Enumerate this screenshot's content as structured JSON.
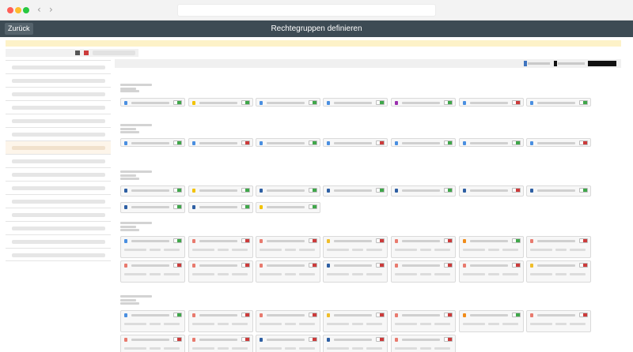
{
  "window": {
    "traffic_colors": [
      "#ff5f57",
      "#febc2e",
      "#28c840"
    ]
  },
  "header": {
    "title": "Rechtegruppen definieren",
    "back_label": "Zurück"
  },
  "colors": {
    "blue": "#4a8fe0",
    "yellow": "#f2c200",
    "purple": "#9b2fae",
    "green": "#3fa74a",
    "red": "#cc3b3b",
    "navy": "#2e5fa3",
    "salmon": "#e87a6e",
    "orange": "#f08c1a",
    "mustard": "#efbd2a"
  },
  "sidebar": {
    "item_count": 15,
    "active_index": 6
  },
  "sections": [
    {
      "cards": [
        {
          "icon": "blue",
          "state": "green"
        },
        {
          "icon": "yellow",
          "state": "green"
        },
        {
          "icon": "blue",
          "state": "green"
        },
        {
          "icon": "blue",
          "state": "green"
        },
        {
          "icon": "purple",
          "state": "green"
        },
        {
          "icon": "blue",
          "state": "red"
        },
        {
          "icon": "blue",
          "state": "green"
        }
      ]
    },
    {
      "cards": [
        {
          "icon": "blue",
          "state": "green"
        },
        {
          "icon": "blue",
          "state": "red"
        },
        {
          "icon": "blue",
          "state": "green"
        },
        {
          "icon": "blue",
          "state": "red"
        },
        {
          "icon": "blue",
          "state": "green"
        },
        {
          "icon": "blue",
          "state": "green"
        },
        {
          "icon": "blue",
          "state": "red"
        }
      ]
    },
    {
      "cards": [
        {
          "icon": "navy",
          "state": "green"
        },
        {
          "icon": "yellow",
          "state": "green"
        },
        {
          "icon": "navy",
          "state": "green"
        },
        {
          "icon": "navy",
          "state": "green"
        },
        {
          "icon": "navy",
          "state": "green"
        },
        {
          "icon": "navy",
          "state": "red"
        },
        {
          "icon": "navy",
          "state": "green"
        },
        {
          "icon": "navy",
          "state": "green"
        },
        {
          "icon": "navy",
          "state": "green"
        },
        {
          "icon": "yellow",
          "state": "green"
        }
      ]
    },
    {
      "cards": [
        {
          "icon": "blue",
          "state": "green"
        },
        {
          "icon": "salmon",
          "state": "red"
        },
        {
          "icon": "salmon",
          "state": "red"
        },
        {
          "icon": "mustard",
          "state": "red"
        },
        {
          "icon": "salmon",
          "state": "red"
        },
        {
          "icon": "orange",
          "state": "green"
        },
        {
          "icon": "salmon",
          "state": "red"
        },
        {
          "icon": "salmon",
          "state": "red"
        },
        {
          "icon": "salmon",
          "state": "red"
        },
        {
          "icon": "salmon",
          "state": "red"
        },
        {
          "icon": "navy",
          "state": "red"
        },
        {
          "icon": "salmon",
          "state": "red"
        },
        {
          "icon": "salmon",
          "state": "red"
        },
        {
          "icon": "mustard",
          "state": "red"
        }
      ]
    },
    {
      "cards": [
        {
          "icon": "blue",
          "state": "green"
        },
        {
          "icon": "salmon",
          "state": "red"
        },
        {
          "icon": "salmon",
          "state": "red"
        },
        {
          "icon": "mustard",
          "state": "red"
        },
        {
          "icon": "salmon",
          "state": "red"
        },
        {
          "icon": "orange",
          "state": "green"
        },
        {
          "icon": "salmon",
          "state": "red"
        },
        {
          "icon": "salmon",
          "state": "red"
        },
        {
          "icon": "salmon",
          "state": "red"
        },
        {
          "icon": "navy",
          "state": "red"
        },
        {
          "icon": "navy",
          "state": "red"
        },
        {
          "icon": "salmon",
          "state": "red"
        }
      ]
    }
  ]
}
